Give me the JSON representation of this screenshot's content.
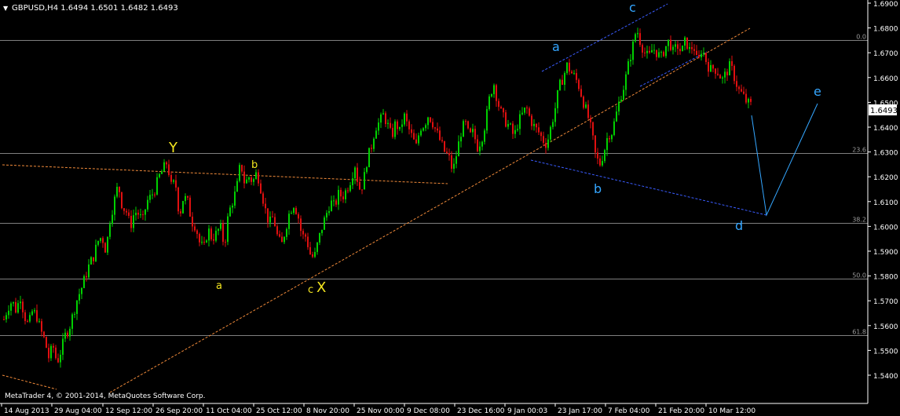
{
  "header": {
    "menu_glyph": "▼",
    "symbol_text": "GBPUSD,H4  1.6494 1.6501 1.6482 1.6493"
  },
  "copyright": "MetaTrader 4, © 2001-2014, MetaQuotes Software Corp.",
  "colors": {
    "background": "#000000",
    "bull": "#00d000",
    "bear": "#e01010",
    "axis_text": "#ffffff",
    "grid": "#7f7f7f",
    "fib_text": "#9a9a9a",
    "orange": "#f08a3a",
    "yellow": "#f3e51f",
    "cyan": "#34a6ff",
    "blue_dash": "#3a5cff"
  },
  "chart_data": {
    "type": "candlestick",
    "symbol": "GBPUSD",
    "timeframe": "H4",
    "ohlc_header": {
      "open": 1.6494,
      "high": 1.6501,
      "low": 1.6482,
      "close": 1.6493
    },
    "current_price_label": "1.6493",
    "ylim": [
      1.54,
      1.69
    ],
    "y_ticks": [
      "1.6900",
      "1.6800",
      "1.6700",
      "1.6600",
      "1.6500",
      "1.6400",
      "1.6300",
      "1.6200",
      "1.6100",
      "1.6000",
      "1.5900",
      "1.5800",
      "1.5700",
      "1.5600",
      "1.5500",
      "1.5400"
    ],
    "x_ticks": [
      "14 Aug 2013",
      "29 Aug 04:00",
      "12 Sep 12:00",
      "26 Sep 20:00",
      "11 Oct 04:00",
      "25 Oct 12:00",
      "8 Nov 20:00",
      "25 Nov 00:00",
      "9 Dec 08:00",
      "23 Dec 16:00",
      "9 Jan 00:03",
      "23 Jan 17:00",
      "7 Feb 04:00",
      "21 Feb 20:00",
      "10 Mar 12:00"
    ],
    "fib_levels": [
      {
        "label": "0.0",
        "price": 1.6752
      },
      {
        "label": "23.6",
        "price": 1.6297
      },
      {
        "label": "38.2",
        "price": 1.6015
      },
      {
        "label": "50.0",
        "price": 1.5788
      },
      {
        "label": "61.8",
        "price": 1.5561
      }
    ],
    "wave_labels": [
      {
        "text": "Y",
        "color": "yellow"
      },
      {
        "text": "b",
        "color": "yellow"
      },
      {
        "text": "a",
        "color": "yellow"
      },
      {
        "text": "c",
        "color": "yellow"
      },
      {
        "text": "X",
        "color": "yellow"
      },
      {
        "text": "a",
        "color": "cyan"
      },
      {
        "text": "c",
        "color": "cyan"
      },
      {
        "text": "b",
        "color": "cyan"
      },
      {
        "text": "d",
        "color": "cyan"
      },
      {
        "text": "e",
        "color": "cyan"
      }
    ],
    "price_path": [
      [
        1.5625,
        1.5675,
        1.57,
        1.566,
        1.572,
        1.564,
        1.56,
        1.566,
        1.564,
        1.558,
        1.554,
        1.547,
        1.552,
        1.545,
        1.55,
        1.556,
        1.559,
        1.565,
        1.571,
        1.575,
        1.58,
        1.585,
        1.588,
        1.594,
        1.596,
        1.59,
        1.603,
        1.61,
        1.617,
        1.608,
        1.606,
        1.6,
        1.606,
        1.605,
        1.602,
        1.61,
        1.612,
        1.615,
        1.62,
        1.623,
        1.626,
        1.616,
        1.618,
        1.604,
        1.612,
        1.61,
        1.602,
        1.6,
        1.593,
        1.591,
        1.599,
        1.595,
        1.597,
        1.6,
        1.592,
        1.605,
        1.61,
        1.615,
        1.626,
        1.617,
        1.62,
        1.618,
        1.622,
        1.615,
        1.607,
        1.601,
        1.604,
        1.596,
        1.592,
        1.599,
        1.606,
        1.609,
        1.605,
        1.596,
        1.596,
        1.589,
        1.587,
        1.594,
        1.6,
        1.605,
        1.61,
        1.608,
        1.613,
        1.612,
        1.615,
        1.619,
        1.625,
        1.615,
        1.617,
        1.627,
        1.632,
        1.64,
        1.642,
        1.645,
        1.641,
        1.636,
        1.642,
        1.638,
        1.645,
        1.64,
        1.636,
        1.632,
        1.64,
        1.641,
        1.645,
        1.642,
        1.638,
        1.634,
        1.63,
        1.628,
        1.622,
        1.63,
        1.638,
        1.642,
        1.636,
        1.638,
        1.632,
        1.635,
        1.642,
        1.652,
        1.658,
        1.65,
        1.645,
        1.642,
        1.64,
        1.636,
        1.642,
        1.645,
        1.648,
        1.643,
        1.64,
        1.638,
        1.635,
        1.633,
        1.64,
        1.647,
        1.656,
        1.66,
        1.665,
        1.662,
        1.66,
        1.656,
        1.65,
        1.645,
        1.638,
        1.628,
        1.625,
        1.63,
        1.637,
        1.638,
        1.645,
        1.652,
        1.657,
        1.665,
        1.672,
        1.68,
        1.674,
        1.67,
        1.668,
        1.672,
        1.67,
        1.668,
        1.672,
        1.675,
        1.67,
        1.673,
        1.67,
        1.675,
        1.671,
        1.673,
        1.665,
        1.672,
        1.667,
        1.663,
        1.664,
        1.662,
        1.659,
        1.662,
        1.665,
        1.66,
        1.655,
        1.653,
        1.65,
        1.649
      ]
    ]
  }
}
